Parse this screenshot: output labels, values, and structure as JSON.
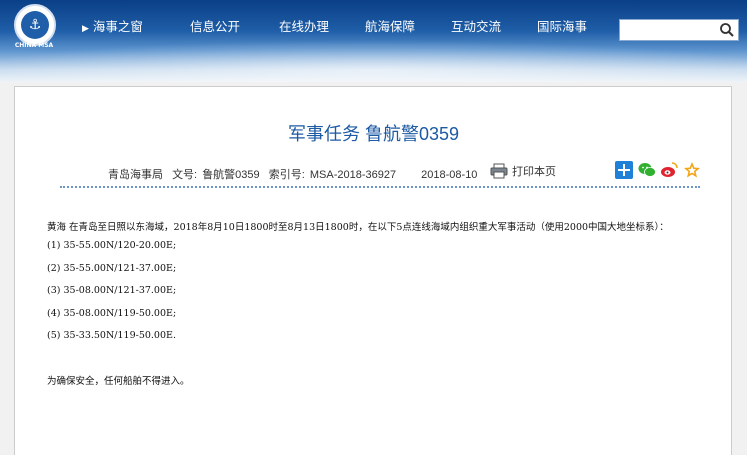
{
  "header": {
    "logo_text": "CHINA MSA",
    "nav": [
      {
        "label": "海事之窗"
      },
      {
        "label": "信息公开"
      },
      {
        "label": "在线办理"
      },
      {
        "label": "航海保障"
      },
      {
        "label": "互动交流"
      },
      {
        "label": "国际海事"
      }
    ],
    "search_placeholder": ""
  },
  "article": {
    "title": "军事任务 鲁航警0359",
    "publisher": "青岛海事局",
    "doc_no_label": "文号:",
    "doc_no": "鲁航警0359",
    "index_label": "索引号:",
    "index_no": "MSA-2018-36927",
    "date": "2018-08-10",
    "print_label": "打印本页",
    "intro": "黄海   在青岛至日照以东海域，2018年8月10日1800时至8月13日1800时，在以下5点连线海域内组织重大军事活动（使用2000中国大地坐标系）：",
    "points": [
      "(1) 35-55.00N/120-20.00E;",
      "(2) 35-55.00N/121-37.00E;",
      "(3) 35-08.00N/121-37.00E;",
      "(4) 35-08.00N/119-50.00E;",
      "(5) 35-33.50N/119-50.00E."
    ],
    "notice": "为确保安全，任何船舶不得进入。"
  },
  "colors": {
    "title": "#1c5aa3",
    "header_dark": "#0a3f86",
    "share_plus": "#1e80d6",
    "share_wechat": "#2fb02f",
    "share_weibo": "#e0232e",
    "share_fav": "#f2a516"
  }
}
